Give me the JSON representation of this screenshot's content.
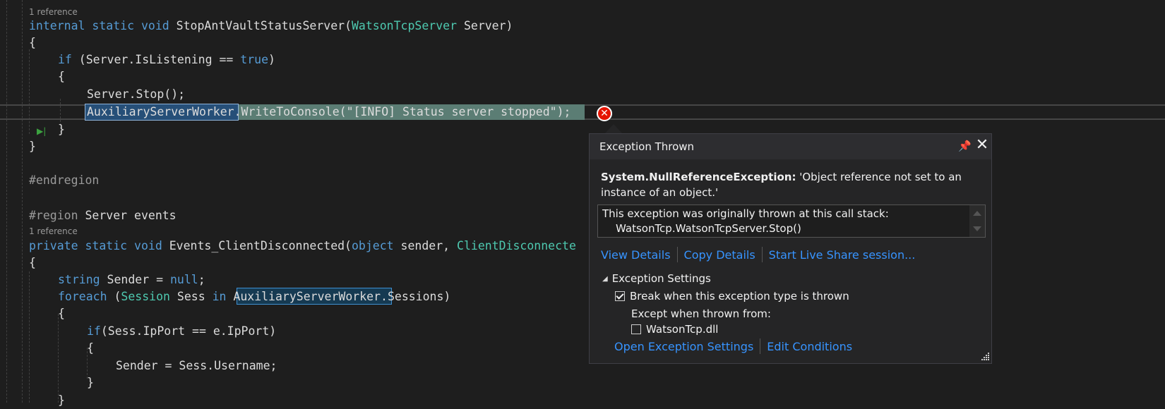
{
  "editor": {
    "codelens": [
      "1 reference",
      "1 reference"
    ],
    "lines": {
      "l1": {
        "kw1": "internal",
        "kw2": "static",
        "kw3": "void",
        "name": " StopAntVaultStatusServer(",
        "type": "WatsonTcpServer",
        "rest": " Server)"
      },
      "l2": "{",
      "l3": {
        "kw": "if",
        "pre": " (Server.IsListening == ",
        "val": "true",
        "post": ")"
      },
      "l4": "{",
      "l5": "Server.Stop();",
      "l6": {
        "obj": "AuxiliaryServerWorker",
        "rest": ".WriteToConsole(\"[INFO] Status server stopped\");"
      },
      "l7": "}",
      "l8": "}",
      "l9": "#endregion",
      "l10": {
        "directive": "#region",
        "rest": " Server events"
      },
      "l11": {
        "kw1": "private",
        "kw2": "static",
        "kw3": "void",
        "name": " Events_ClientDisconnected(",
        "kw4": "object",
        "mid": " sender, ",
        "type": "ClientDisconnecte"
      },
      "l12": "{",
      "l13": {
        "kw": "string",
        "mid": " Sender = ",
        "val": "null",
        "post": ";"
      },
      "l14": {
        "kw": "foreach",
        "pre": " (",
        "type": "Session",
        "mid": " Sess ",
        "kw2": "in",
        "sp": " ",
        "obj": "AuxiliaryServerWorker",
        "post": ".Sessions)"
      },
      "l15": "{",
      "l16": {
        "kw": "if",
        "rest": "(Sess.IpPort == e.IpPort)"
      },
      "l17": "{",
      "l18": "Sender = Sess.Username;",
      "l19": "}",
      "l20": "}"
    }
  },
  "popup": {
    "title": "Exception Thrown",
    "exception_type": "System.NullReferenceException:",
    "exception_message": " 'Object reference not set to an instance of an object.'",
    "callstack_header": "This exception was originally thrown at this call stack:",
    "callstack_frame": "WatsonTcp.WatsonTcpServer.Stop()",
    "links": [
      "View Details",
      "Copy Details",
      "Start Live Share session..."
    ],
    "settings_title": "Exception Settings",
    "break_label": "Break when this exception type is thrown",
    "break_checked": true,
    "except_label": "Except when thrown from:",
    "module_label": "WatsonTcp.dll",
    "module_checked": false,
    "footer_links": [
      "Open Exception Settings",
      "Edit Conditions"
    ]
  },
  "icons": {
    "pin": "pin-icon",
    "close": "close-icon",
    "error": "error-icon",
    "run": "run-to-cursor-icon",
    "collapse": "collapse-triangle-icon"
  },
  "colors": {
    "keyword": "#569cd6",
    "type": "#4ec9b0",
    "link": "#3794ff",
    "error": "#e51400",
    "statement_highlight": "#5b7d74"
  }
}
